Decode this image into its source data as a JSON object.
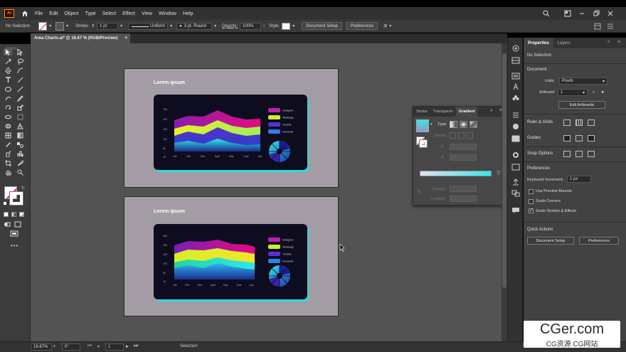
{
  "app": {
    "logo": "Ai"
  },
  "menu": [
    "File",
    "Edit",
    "Object",
    "Type",
    "Select",
    "Effect",
    "View",
    "Window",
    "Help"
  ],
  "control": {
    "selection": "No Selection",
    "stroke_label": "Stroke:",
    "stroke_value": "1 pt",
    "profile": "Uniform",
    "brush": "3 pt. Round",
    "opacity_label": "Opacity:",
    "opacity_value": "100%",
    "style_label": "Style:",
    "doc_setup": "Document Setup",
    "preferences": "Preferences"
  },
  "document_tab": {
    "title": "Area Charts.ai* @ 16.67 % (RGB/Preview)"
  },
  "artboards": [
    {
      "title": "Lorem ipsum",
      "y_ticks": [
        "240",
        "200",
        "160",
        "120",
        "80",
        "40"
      ],
      "months": [
        "Jan",
        "Feb",
        "Mar",
        "April",
        "May",
        "June",
        "July"
      ],
      "legend": [
        "Instagram",
        "Whatsapp",
        "Youtube",
        "Facebook"
      ]
    },
    {
      "title": "Lorem ipsum",
      "y_ticks": [
        "280",
        "200",
        "160",
        "120",
        "80",
        "40"
      ],
      "months": [
        "Jan",
        "Feb",
        "Mar",
        "April",
        "May",
        "June",
        "July"
      ],
      "legend": [
        "Instagram",
        "Whatsapp",
        "Youtube",
        "Facebook"
      ]
    }
  ],
  "gradient_panel": {
    "tabs": [
      "Stroke",
      "Transparen",
      "Gradient"
    ],
    "type_label": "Type:",
    "stroke_label": "Stroke:",
    "opacity_label": "Opacity:",
    "location_label": "Location:"
  },
  "properties": {
    "tabs": [
      "Properties",
      "Layers"
    ],
    "selection": "No Selection",
    "document_heading": "Document",
    "units_label": "Units:",
    "units_value": "Pixels",
    "artboard_label": "Artboard:",
    "artboard_value": "1",
    "edit_artboards": "Edit Artboards",
    "rulers_grids": "Ruler & Grids",
    "guides": "Guides",
    "snap_options": "Snap Options",
    "preferences_heading": "Preferences",
    "keyboard_increment_label": "Keyboard Increment:",
    "keyboard_increment_value": "1 px",
    "checkboxes": [
      {
        "label": "Use Preview Bounds",
        "checked": false
      },
      {
        "label": "Scale Corners",
        "checked": false
      },
      {
        "label": "Scale Strokes & Effects",
        "checked": true
      }
    ],
    "quick_actions": "Quick Actions",
    "doc_setup": "Document Setup",
    "preferences": "Preferences"
  },
  "status": {
    "zoom": "16.67%",
    "angle": "0°",
    "artboard": "1",
    "tool": "Selection"
  },
  "watermark": {
    "line1": "CGer.com",
    "line2": "CG资源 CG网站"
  },
  "colors": {
    "instagram": "#d40a8c",
    "whatsapp": "#c6f032",
    "youtube": "#7a4ad8",
    "facebook": "#2fe8e8",
    "card_glow": "#22dfe3"
  }
}
